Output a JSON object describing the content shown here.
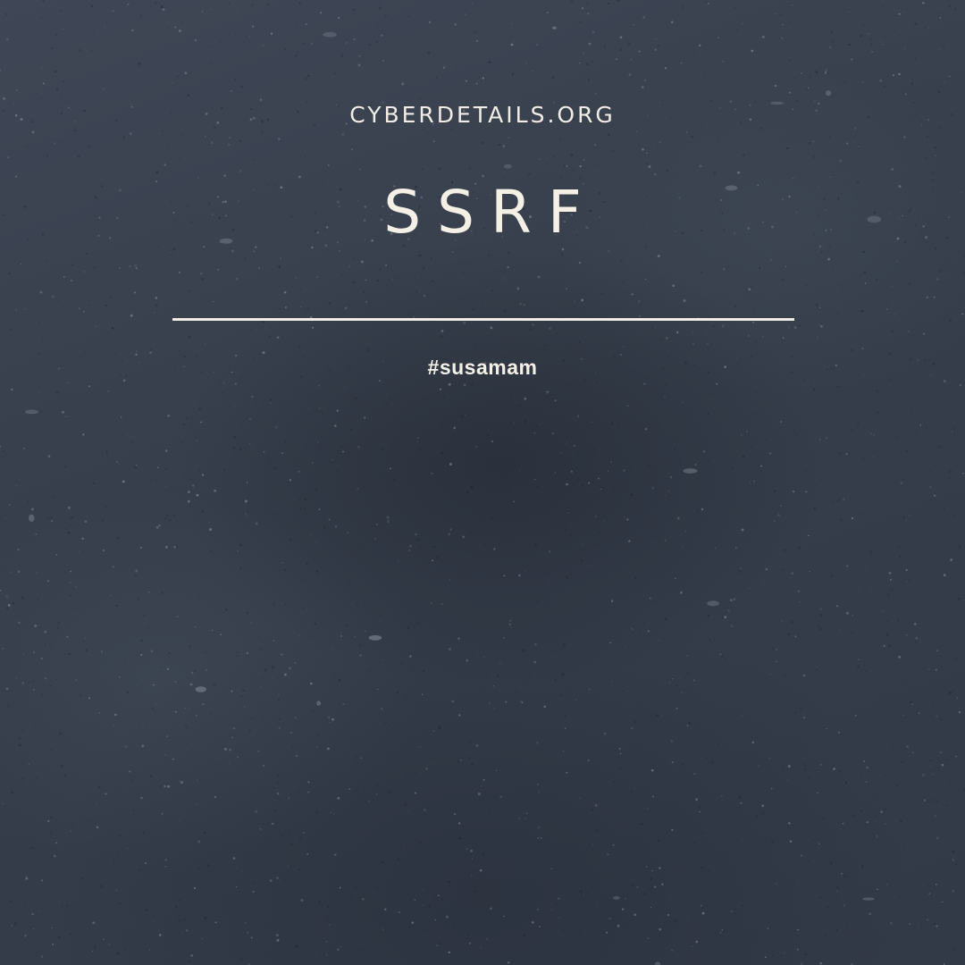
{
  "header": {
    "site_name": "CYBERDETAILS.ORG",
    "title": "SSRF"
  },
  "footer_tag": {
    "hashtag": "#susamam"
  },
  "colors": {
    "background": "#3a4250",
    "text": "#f1ede4",
    "divider": "#f1ede4"
  },
  "background": {
    "texture": "dark grey sand"
  }
}
